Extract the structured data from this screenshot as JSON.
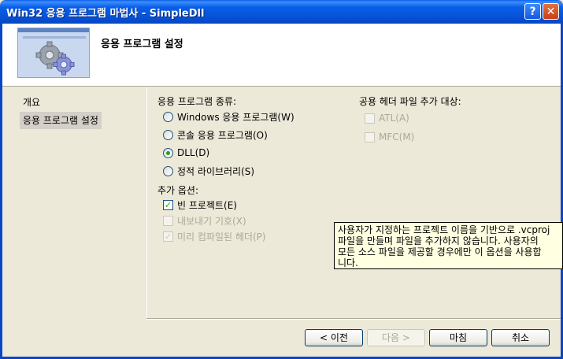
{
  "window": {
    "title": "Win32 응용 프로그램 마법사 - SimpleDll",
    "help_glyph": "?",
    "close_glyph": "✕"
  },
  "banner": {
    "title": "응용 프로그램 설정",
    "icon": "gears-icon"
  },
  "nav": {
    "items": [
      {
        "label": "개요",
        "selected": false
      },
      {
        "label": "응용 프로그램 설정",
        "selected": true
      }
    ]
  },
  "app_type": {
    "heading": "응용 프로그램 종류:",
    "options": [
      {
        "label": "Windows 응용 프로그램(W)",
        "selected": false
      },
      {
        "label": "콘솔 응용 프로그램(O)",
        "selected": false
      },
      {
        "label": "DLL(D)",
        "selected": true
      },
      {
        "label": "정적 라이브러리(S)",
        "selected": false
      }
    ]
  },
  "extra_options": {
    "heading": "추가 옵션:",
    "options": [
      {
        "label": "빈 프로젝트(E)",
        "checked": true,
        "enabled": true
      },
      {
        "label": "내보내기 기호(X)",
        "checked": false,
        "enabled": false
      },
      {
        "label": "미리 컴파일된 헤더(P)",
        "checked": true,
        "enabled": false
      }
    ]
  },
  "common_headers": {
    "heading": "공용 헤더 파일 추가 대상:",
    "options": [
      {
        "label": "ATL(A)",
        "checked": false,
        "enabled": false
      },
      {
        "label": "MFC(M)",
        "checked": false,
        "enabled": false
      }
    ]
  },
  "tooltip": {
    "lines": [
      "사용자가 지정하는 프로젝트 이름을 기반으로 .vcproj",
      "파일을 만들며 파일을 추가하지 않습니다. 사용자의",
      "모든 소스 파일을 제공할 경우에만 이 옵션을 사용합",
      "니다."
    ]
  },
  "buttons": {
    "back": "< 이전",
    "next": "다음 >",
    "finish": "마침",
    "cancel": "취소"
  },
  "colors": {
    "titlebar": "#0a5ee8",
    "radio_dot": "#21a121",
    "tooltip_bg": "#ffffe1"
  }
}
